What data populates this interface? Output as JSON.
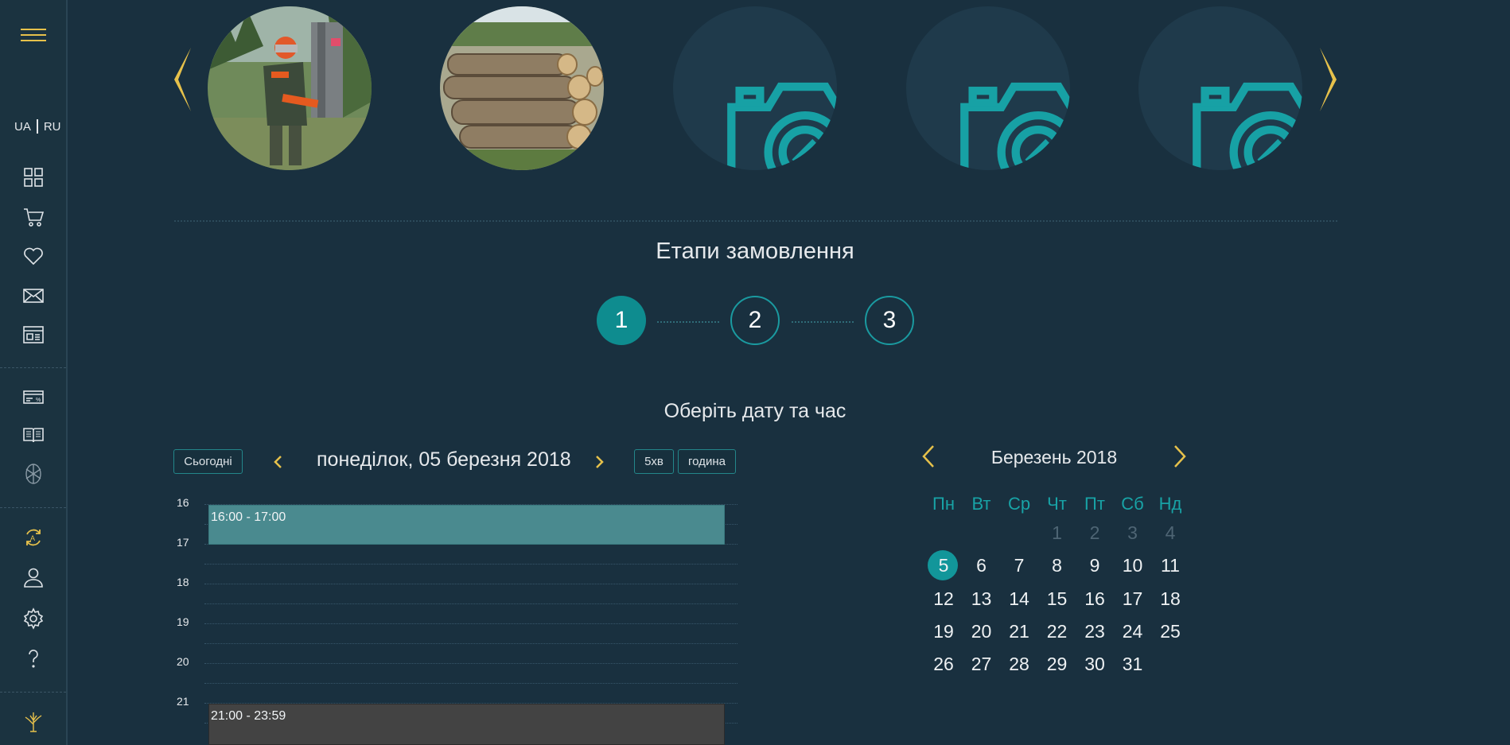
{
  "sidebar": {
    "languages": [
      "UA",
      "RU"
    ],
    "icons": [
      "dashboard-icon",
      "cart-icon",
      "heart-icon",
      "mail-icon",
      "news-icon",
      "card-discount-icon",
      "book-icon",
      "aperture-icon",
      "sync-icon",
      "user-icon",
      "settings-icon",
      "help-icon",
      "tree-icon"
    ]
  },
  "gallery": {
    "photos": [
      "lumberjack-photo",
      "logs-photo",
      "camera-placeholder",
      "camera-placeholder",
      "camera-placeholder"
    ]
  },
  "stages": {
    "title": "Етапи замовлення",
    "steps": [
      "1",
      "2",
      "3"
    ],
    "active": 1
  },
  "schedule": {
    "subtitle": "Оберіть дату та час",
    "today_button": "Сьогодні",
    "date": "понеділок, 05 березня 2018",
    "interval_5": "5хв",
    "interval_hour": "година",
    "hours": [
      "16",
      "17",
      "18",
      "19",
      "20",
      "21"
    ],
    "events": [
      {
        "label": "16:00 - 17:00",
        "status": "free"
      },
      {
        "label": "21:00 - 23:59",
        "status": "busy"
      }
    ]
  },
  "calendar": {
    "title": "Березень 2018",
    "weekdays": [
      "Пн",
      "Вт",
      "Ср",
      "Чт",
      "Пт",
      "Сб",
      "Нд"
    ],
    "weeks": [
      [
        "",
        "",
        "",
        "1",
        "2",
        "3",
        "4"
      ],
      [
        "5",
        "6",
        "7",
        "8",
        "9",
        "10",
        "11"
      ],
      [
        "12",
        "13",
        "14",
        "15",
        "16",
        "17",
        "18"
      ],
      [
        "19",
        "20",
        "21",
        "22",
        "23",
        "24",
        "25"
      ],
      [
        "26",
        "27",
        "28",
        "29",
        "30",
        "31",
        ""
      ]
    ],
    "selected": "5",
    "muted": [
      "1",
      "2",
      "3",
      "4"
    ]
  },
  "colors": {
    "accent": "#12969a",
    "gold": "#e6c14b",
    "background": "#19303f"
  }
}
